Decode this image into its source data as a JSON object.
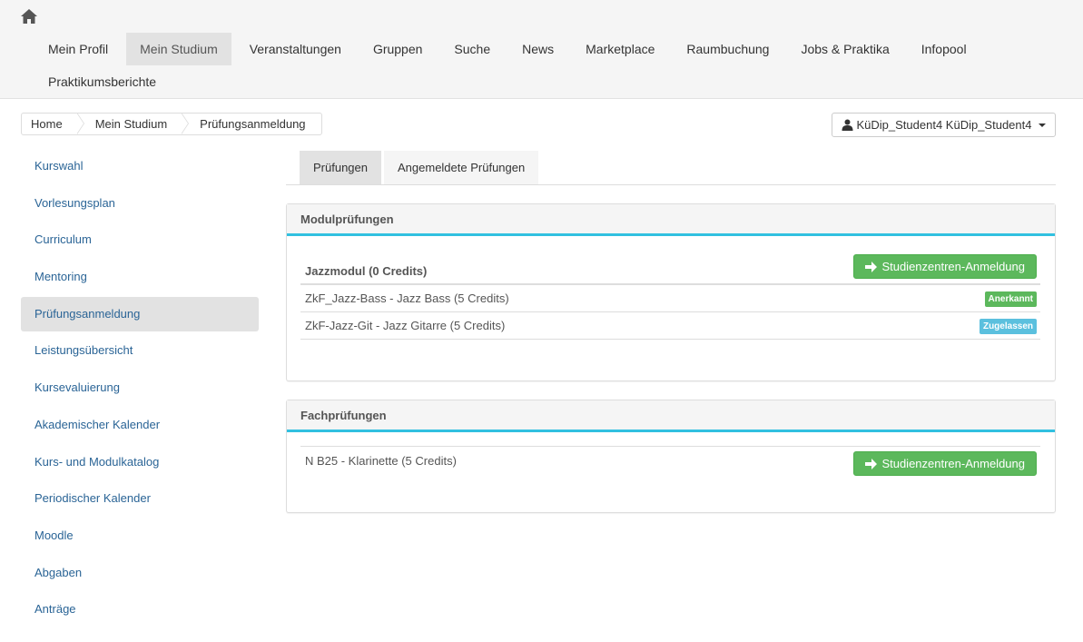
{
  "nav": {
    "row1": [
      "Mein Profil",
      "Mein Studium",
      "Veranstaltungen",
      "Gruppen",
      "Suche",
      "News",
      "Marketplace",
      "Raumbuchung",
      "Jobs & Praktika",
      "Infopool"
    ],
    "row2": [
      "Praktikumsberichte"
    ],
    "active_index": 1
  },
  "breadcrumb": [
    "Home",
    "Mein Studium",
    "Prüfungsanmeldung"
  ],
  "user": {
    "name": "KüDip_Student4 KüDip_Student4"
  },
  "sidebar": {
    "items": [
      "Kurswahl",
      "Vorlesungsplan",
      "Curriculum",
      "Mentoring",
      "Prüfungsanmeldung",
      "Leistungsübersicht",
      "Kursevaluierung",
      "Akademischer Kalender",
      "Kurs- und Modulkatalog",
      "Periodischer Kalender",
      "Moodle",
      "Abgaben",
      "Anträge"
    ],
    "active_index": 4
  },
  "tabs": [
    "Prüfungen",
    "Angemeldete Prüfungen"
  ],
  "modul_panel": {
    "title": "Modulprüfungen",
    "module_title": "Jazzmodul (0 Credits)",
    "register_label": "Studienzentren-Anmeldung",
    "rows": [
      {
        "text": "ZkF_Jazz-Bass - Jazz Bass (5 Credits)",
        "badge": "Anerkannt",
        "badge_color": "#5cb85c"
      },
      {
        "text": "ZkF-Jazz-Git - Jazz Gitarre (5 Credits)",
        "badge": "Zugelassen",
        "badge_color": "#5bc0de"
      }
    ]
  },
  "fach_panel": {
    "title": "Fachprüfungen",
    "row_text": "N B25 - Klarinette (5 Credits)",
    "register_label": "Studienzentren-Anmeldung"
  },
  "colors": {
    "accent": "#31c0e0",
    "link": "#2a6496",
    "success": "#5cb85c",
    "info": "#5bc0de"
  }
}
